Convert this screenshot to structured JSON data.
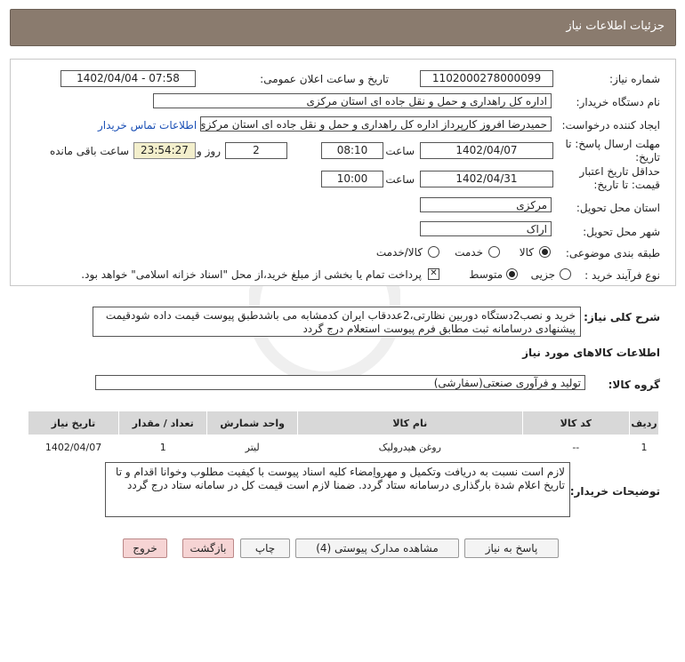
{
  "header": {
    "title": "جزئیات اطلاعات نیاز"
  },
  "form": {
    "need_number_label": "شماره نیاز:",
    "need_number": "1102000278000099",
    "announce_label": "تاریخ و ساعت اعلان عمومی:",
    "announce_value": "1402/04/04 - 07:58",
    "buyer_org_label": "نام دستگاه خریدار:",
    "buyer_org": "اداره کل راهداری و حمل و نقل جاده ای استان مرکزی",
    "creator_label": "ایجاد کننده درخواست:",
    "creator": "حمیدرضا  افروز  کارپرداز اداره کل راهداری و حمل و نقل جاده ای استان مرکزی",
    "contact_link": "اطلاعات تماس خریدار",
    "deadline_label_1": "مهلت ارسال پاسخ: تا",
    "deadline_label_2": "تاریخ:",
    "deadline_date": "1402/04/07",
    "time_label": "ساعت",
    "deadline_time": "08:10",
    "days_value": "2",
    "days_label": "روز و",
    "remaining_time": "23:54:27",
    "remaining_label": "ساعت باقی مانده",
    "validity_label_1": "حداقل تاریخ اعتبار",
    "validity_label_2": "قیمت: تا تاریخ:",
    "validity_date": "1402/04/31",
    "validity_time_label": "ساعت",
    "validity_time": "10:00",
    "province_label": "استان محل تحویل:",
    "province": "مرکزی",
    "city_label": "شهر محل تحویل:",
    "city": "اراک",
    "category_label": "طبقه بندی موضوعی:",
    "category_options": [
      "کالا",
      "خدمت",
      "کالا/خدمت"
    ],
    "process_label": "نوع فرآیند خرید :",
    "process_options": [
      "جزیی",
      "متوسط"
    ],
    "payment_note": "پرداخت تمام یا بخشی از مبلغ خرید،از محل \"اسناد خزانه اسلامی\" خواهد بود."
  },
  "summary": {
    "label": "شرح کلی نیاز:",
    "text": "خرید و نصب2دستگاه دوربین نظارتی،2عددقاب ایران کدمشابه می باشدطبق پیوست قیمت داده شودقیمت پیشنهادی درسامانه ثبت مطابق فرم پیوست استعلام درج گردد"
  },
  "goods": {
    "section_title": "اطلاعات کالاهای مورد نیاز",
    "group_label": "گروه کالا:",
    "group_value": "تولید و فرآوری صنعتی(سفارشی)",
    "columns": [
      "ردیف",
      "کد کالا",
      "نام کالا",
      "واحد شمارش",
      "تعداد / مقدار",
      "تاریخ نیاز"
    ],
    "rows": [
      {
        "index": "1",
        "code": "--",
        "name": "روغن هیدرولیک",
        "unit": "لیتر",
        "qty": "1",
        "date": "1402/04/07"
      }
    ]
  },
  "buyer_notes": {
    "label": "توضیحات خریدار:",
    "text": "لازم است نسبت به دریافت وتکمیل و مهرواِمضاء کلیه اسناد پیوست با کیفیت مطلوب وخوانا اقدام و تا تاریخ اعلام شدة بارگذاری درسامانه ستاد گردد. ضمنا لازم است قیمت کل در سامانه ستاد درج گردد"
  },
  "buttons": {
    "reply": "پاسخ به نیاز",
    "attachments": "مشاهده مدارک پیوستی (4)",
    "print": "چاپ",
    "back": "بازگشت",
    "exit": "خروج"
  }
}
